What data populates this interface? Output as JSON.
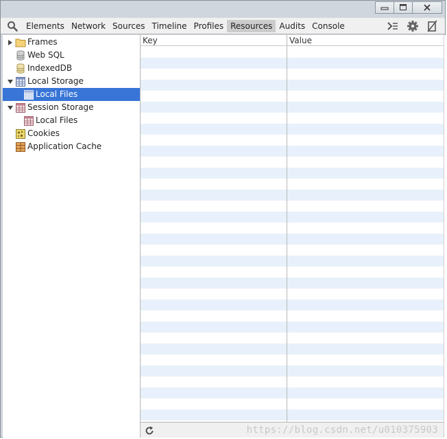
{
  "toolbar": {
    "search_icon": "search-icon",
    "tabs": [
      "Elements",
      "Network",
      "Sources",
      "Timeline",
      "Profiles",
      "Resources",
      "Audits",
      "Console"
    ],
    "active_tab": "Resources",
    "right_icons": [
      "console-drawer-icon",
      "gear-icon",
      "dock-icon"
    ]
  },
  "sidebar": {
    "items": [
      {
        "label": "Frames",
        "icon": "folder-icon",
        "expanded": false
      },
      {
        "label": "Web SQL",
        "icon": "database-icon"
      },
      {
        "label": "IndexedDB",
        "icon": "database-icon"
      },
      {
        "label": "Local Storage",
        "icon": "table-icon",
        "expanded": true
      },
      {
        "label": "Local Files",
        "icon": "table-icon",
        "selected": true
      },
      {
        "label": "Session Storage",
        "icon": "table-icon",
        "expanded": true
      },
      {
        "label": "Local Files",
        "icon": "table-icon"
      },
      {
        "label": "Cookies",
        "icon": "cookie-icon"
      },
      {
        "label": "Application Cache",
        "icon": "app-cache-icon"
      }
    ]
  },
  "grid": {
    "columns": [
      "Key",
      "Value"
    ],
    "rows": []
  },
  "statusbar": {
    "refresh_icon": "refresh-icon",
    "watermark": "https://blog.csdn.net/u010375903"
  },
  "colors": {
    "selection": "#3875d7",
    "stripe": "#e8f1fb",
    "active_tab": "#cccccc"
  }
}
